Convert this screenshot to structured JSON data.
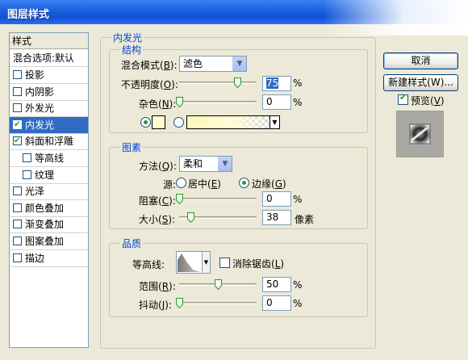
{
  "window": {
    "title": "图层样式"
  },
  "style_list": {
    "header": "样式",
    "blend_options": "混合选项:默认",
    "items": [
      {
        "label": "投影",
        "checked": false,
        "selected": false,
        "indent": false
      },
      {
        "label": "内阴影",
        "checked": false,
        "selected": false,
        "indent": false
      },
      {
        "label": "外发光",
        "checked": false,
        "selected": false,
        "indent": false
      },
      {
        "label": "内发光",
        "checked": true,
        "selected": true,
        "indent": false
      },
      {
        "label": "斜面和浮雕",
        "checked": true,
        "selected": false,
        "indent": false
      },
      {
        "label": "等高线",
        "checked": false,
        "selected": false,
        "indent": true
      },
      {
        "label": "纹理",
        "checked": false,
        "selected": false,
        "indent": true
      },
      {
        "label": "光泽",
        "checked": false,
        "selected": false,
        "indent": false
      },
      {
        "label": "颜色叠加",
        "checked": false,
        "selected": false,
        "indent": false
      },
      {
        "label": "渐变叠加",
        "checked": false,
        "selected": false,
        "indent": false
      },
      {
        "label": "图案叠加",
        "checked": false,
        "selected": false,
        "indent": false
      },
      {
        "label": "描边",
        "checked": false,
        "selected": false,
        "indent": false
      }
    ]
  },
  "panel": {
    "title": "内发光",
    "structure": {
      "title": "结构",
      "blend_mode_label": "混合模式(",
      "blend_mode_key": "B",
      "blend_mode_value": "滤色",
      "opacity_label": "不透明度(",
      "opacity_key": "O",
      "opacity_value": "75",
      "opacity_fraction": 0.75,
      "opacity_unit": "%",
      "noise_label": "杂色(",
      "noise_key": "N",
      "noise_value": "0",
      "noise_fraction": 0,
      "noise_unit": "%",
      "color_swatch": "#fffbd0",
      "gradient_start": "#fff7b8"
    },
    "elements": {
      "title": "图素",
      "method_label": "方法(",
      "method_key": "Q",
      "method_value": "柔和",
      "source_label": "源:",
      "center_label": "居中(",
      "center_key": "E",
      "edge_label": "边缘(",
      "edge_key": "G",
      "choke_label": "阻塞(",
      "choke_key": "C",
      "choke_value": "0",
      "choke_fraction": 0,
      "choke_unit": "%",
      "size_label": "大小(",
      "size_key": "S",
      "size_value": "38",
      "size_fraction": 0.15,
      "size_unit": "像素"
    },
    "quality": {
      "title": "品质",
      "contour_label": "等高线:",
      "antialias_label": "消除锯齿(",
      "antialias_key": "L",
      "range_label": "范围(",
      "range_key": "R",
      "range_value": "50",
      "range_fraction": 0.5,
      "range_unit": "%",
      "jitter_label": "抖动(",
      "jitter_key": "J",
      "jitter_value": "0",
      "jitter_fraction": 0,
      "jitter_unit": "%"
    }
  },
  "buttons": {
    "cancel": "取消",
    "new_style": "新建样式(W)...",
    "preview_label": "预览(",
    "preview_key": "V",
    "preview_checked": true
  },
  "colors": {
    "title_bar": "#1b5fdc",
    "selection": "#316ac5",
    "section_title": "#0046d5",
    "check_mark": "#21a121"
  }
}
